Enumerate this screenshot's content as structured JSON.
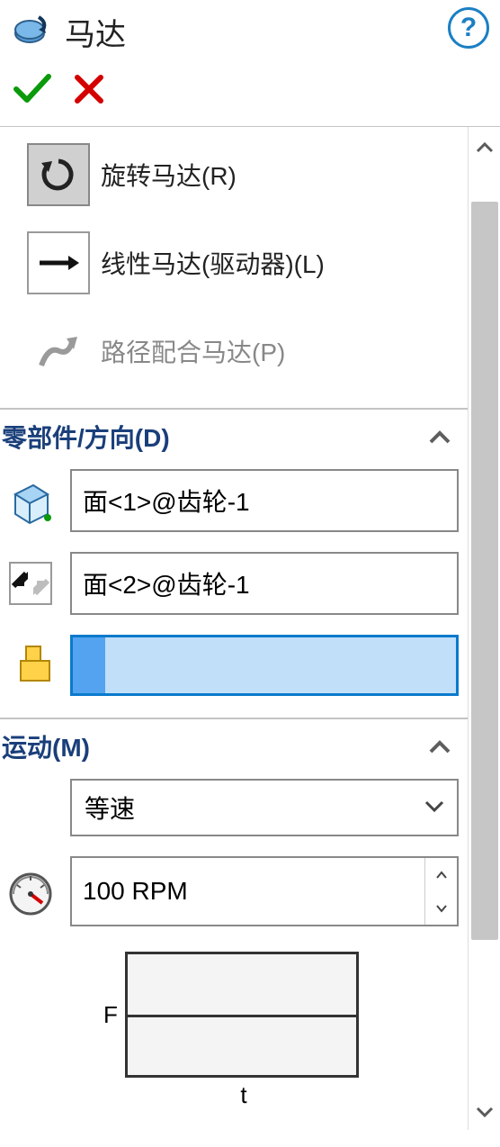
{
  "header": {
    "title": "马达"
  },
  "motorTypes": {
    "rotary": "旋转马达(R)",
    "linear": "线性马达(驱动器)(L)",
    "path": "路径配合马达(P)"
  },
  "componentSection": {
    "title": "零部件/方向(D)",
    "face1": "面<1>@齿轮-1",
    "face2": "面<2>@齿轮-1"
  },
  "motionSection": {
    "title": "运动(M)",
    "type": "等速",
    "speed": "100 RPM",
    "yLabel": "F",
    "xLabel": "t"
  }
}
